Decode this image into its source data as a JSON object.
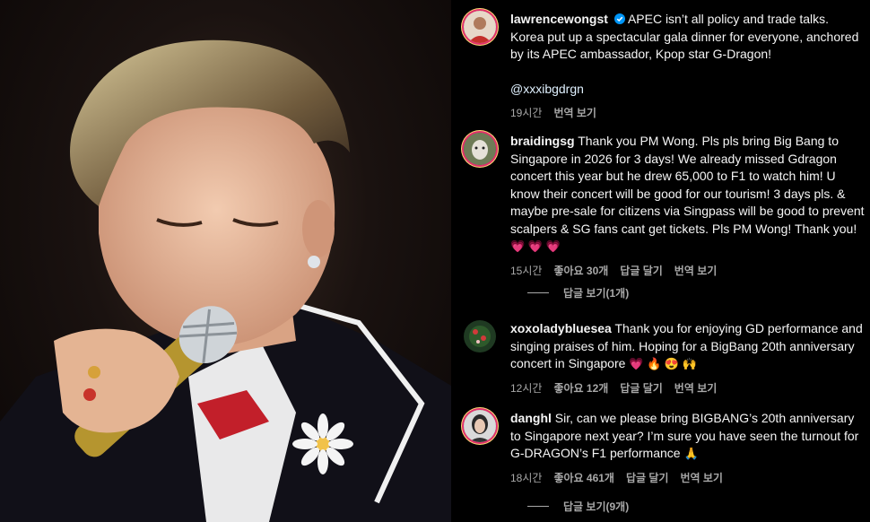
{
  "caption": {
    "username": "lawrencewongst",
    "text": " APEC isn’t all policy and trade talks. Korea put up a spectacular gala dinner for everyone, anchored by its APEC ambassador, Kpop star G-Dragon!",
    "mention": "@xxxibgdrgn",
    "time": "19시간",
    "translate": "번역 보기"
  },
  "comments": [
    {
      "username": "braidingsg",
      "text": " Thank you PM Wong. Pls pls bring Big Bang to Singapore in 2026 for 3 days! We already missed Gdragon concert this year but he drew 65,000 to F1 to watch him! U know their concert will be good for our tourism! 3 days pls. & maybe pre-sale for citizens via Singpass will be good to prevent scalpers & SG fans cant get tickets. Pls PM Wong! Thank you! ",
      "emojis": "💗 💗 💗",
      "time": "15시간",
      "likes": "좋아요 30개",
      "reply": "답글 달기",
      "translate": "번역 보기",
      "view_replies": "답글 보기(1개)"
    },
    {
      "username": "xoxoladybluesea",
      "text": " Thank you for enjoying GD performance and singing praises of him. Hoping for a BigBang 20th anniversary concert in Singapore ",
      "emojis": "💗 🔥 😍 🙌",
      "time": "12시간",
      "likes": "좋아요 12개",
      "reply": "답글 달기",
      "translate": "번역 보기"
    },
    {
      "username": "danghl",
      "text": " Sir, can we please bring BIGBANG’s 20th anniversary to Singapore next year? I’m sure you have seen the turnout for G-DRAGON’s F1 performance ",
      "emojis": "🙏",
      "time": "18시간",
      "likes": "좋아요 461개",
      "reply": "답글 달기",
      "translate": "번역 보기",
      "view_replies": "답글 보기(9개)"
    }
  ],
  "colors": {
    "verified": "#0095f6",
    "mention": "#e0f1ff",
    "meta": "#a8a8a8"
  }
}
